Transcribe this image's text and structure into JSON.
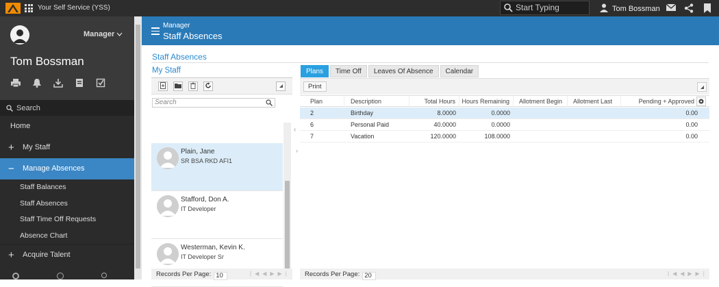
{
  "topbar": {
    "app_title": "Your Self Service (YSS)",
    "search_placeholder": "Start Typing",
    "user_name": "Tom Bossman"
  },
  "sidebar": {
    "role": "Manager",
    "name": "Tom Bossman",
    "search_label": "Search",
    "items": [
      {
        "label": "Home"
      },
      {
        "label": "My Staff",
        "sign": "+"
      },
      {
        "label": "Manage Absences",
        "sign": "−"
      }
    ],
    "sub_items": [
      "Staff Balances",
      "Staff Absences",
      "Staff Time Off Requests",
      "Absence Chart"
    ],
    "acquire": {
      "label": "Acquire Talent",
      "sign": "+"
    }
  },
  "header": {
    "section": "Manager",
    "title": "Staff Absences"
  },
  "page_title": "Staff Absences",
  "my_staff": {
    "title": "My Staff",
    "search_placeholder": "Search",
    "staff": [
      {
        "name": "Plain, Jane",
        "title": "SR BSA RKD AFI1"
      },
      {
        "name": "Stafford, Don A.",
        "title": "IT Developer"
      },
      {
        "name": "Westerman, Kevin K.",
        "title": "IT Developer Sr"
      }
    ],
    "records_per_page_label": "Records Per Page:",
    "records_per_page": "10"
  },
  "tabs": [
    "Plans",
    "Time Off",
    "Leaves Of Absence",
    "Calendar"
  ],
  "toolbar": {
    "print_label": "Print"
  },
  "table": {
    "columns": [
      "Plan",
      "Description",
      "Total Hours",
      "Hours Remaining",
      "Allotment Begin",
      "Allotment Last",
      "Pending + Approved"
    ],
    "rows": [
      {
        "plan": "2",
        "description": "Birthday",
        "total": "8.0000",
        "remaining": "0.0000",
        "begin": "",
        "last": "",
        "pending": "0.00"
      },
      {
        "plan": "6",
        "description": "Personal Paid",
        "total": "40.0000",
        "remaining": "0.0000",
        "begin": "",
        "last": "",
        "pending": "0.00"
      },
      {
        "plan": "7",
        "description": "Vacation",
        "total": "120.0000",
        "remaining": "108.0000",
        "begin": "",
        "last": "",
        "pending": "0.00"
      }
    ],
    "records_per_page_label": "Records Per Page:",
    "records_per_page": "20"
  },
  "colors": {
    "header_blue": "#2a7ab8",
    "active_tab": "#2aa0e0",
    "nav_active": "#3b86c4",
    "logo": "#f08a00"
  }
}
